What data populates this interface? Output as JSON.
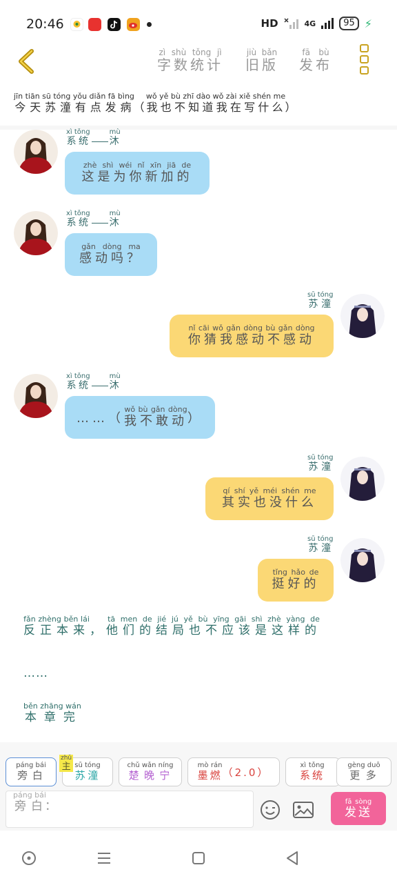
{
  "status": {
    "time": "20:46",
    "right_text": "HD",
    "network": "4G",
    "battery": "95"
  },
  "header": {
    "stats": {
      "text": "字数统计",
      "rt": "zì shù tǒng jì"
    },
    "old": {
      "text": "旧版",
      "rt": "jiù bǎn"
    },
    "publish": {
      "text": "发布",
      "rt": "fā bù"
    }
  },
  "title": {
    "main": "今天苏潼有点发病",
    "main_rt": "jīn tiān sū tóng yǒu diǎn fā bìng",
    "paren_open": "（",
    "aside": "我也不知道我在写什么",
    "aside_rt": "wǒ yě bù zhī dào wǒ zài xiě shén me",
    "paren_close": "）"
  },
  "speakers": {
    "system": {
      "a": "系统",
      "a_rt": "xì tǒng",
      "b": "沐",
      "b_rt": "mù"
    },
    "sutong": {
      "text": "苏潼",
      "rt": "sū tóng"
    }
  },
  "messages": [
    {
      "text": "这是为你新加的",
      "rt": "zhè shì wéi nǐ xīn jiā de"
    },
    {
      "text": "感动吗？",
      "rt": "gǎn dòng ma"
    },
    {
      "text": "你猜我感动不感动",
      "rt": "nǐ cāi wǒ gǎn dòng bù gǎn dòng"
    },
    {
      "prefix": "……（",
      "text": "我不敢动",
      "rt": "wǒ bù gǎn dòng",
      "suffix": "）"
    },
    {
      "text": "其实也没什么",
      "rt": "qí shí yě méi shén me"
    },
    {
      "text": "挺好的",
      "rt": "tǐng hǎo de"
    }
  ],
  "narration": {
    "line1a": "反正本来",
    "line1a_rt": "fǎn zhèng běn lái",
    "comma": "，",
    "line1b": "他们的结局也不应该是这样的",
    "line1b_rt": "tā men de jié jú yě bù yīng gāi shì zhè yàng de",
    "ellipsis": "……",
    "end": "本章完",
    "end_rt": "běn zhāng wán"
  },
  "tray": {
    "narrator": {
      "text": "旁白",
      "rt": "páng bái"
    },
    "main_tag": {
      "text": "主",
      "rt": "zhǔ"
    },
    "sutong": {
      "text": "苏潼",
      "rt": "sū tóng"
    },
    "chuwanning": {
      "text": "楚晚宁",
      "rt": "chǔ wǎn níng"
    },
    "moran": {
      "text": "墨燃",
      "rt": "mò rán",
      "suffix": "（2.0）"
    },
    "system": {
      "text": "系统",
      "rt": "xì tǒng"
    },
    "more": {
      "text": "更多",
      "rt": "gèng duō"
    },
    "input": {
      "text": "旁白",
      "rt": "páng bái",
      "colon": "："
    },
    "send": {
      "text": "发送",
      "rt": "fā sòng"
    }
  },
  "colors": {
    "blue_bubble": "#a9dcf6",
    "yellow_bubble": "#fbd875",
    "send": "#f2649a",
    "speaker": "#3a6e6e",
    "accent": "#c9a320"
  },
  "icons": [
    "back-chevron-icon",
    "more-dots-icon",
    "emoji-icon",
    "image-icon",
    "home-circle-icon",
    "menu-icon",
    "square-icon",
    "back-triangle-icon"
  ]
}
